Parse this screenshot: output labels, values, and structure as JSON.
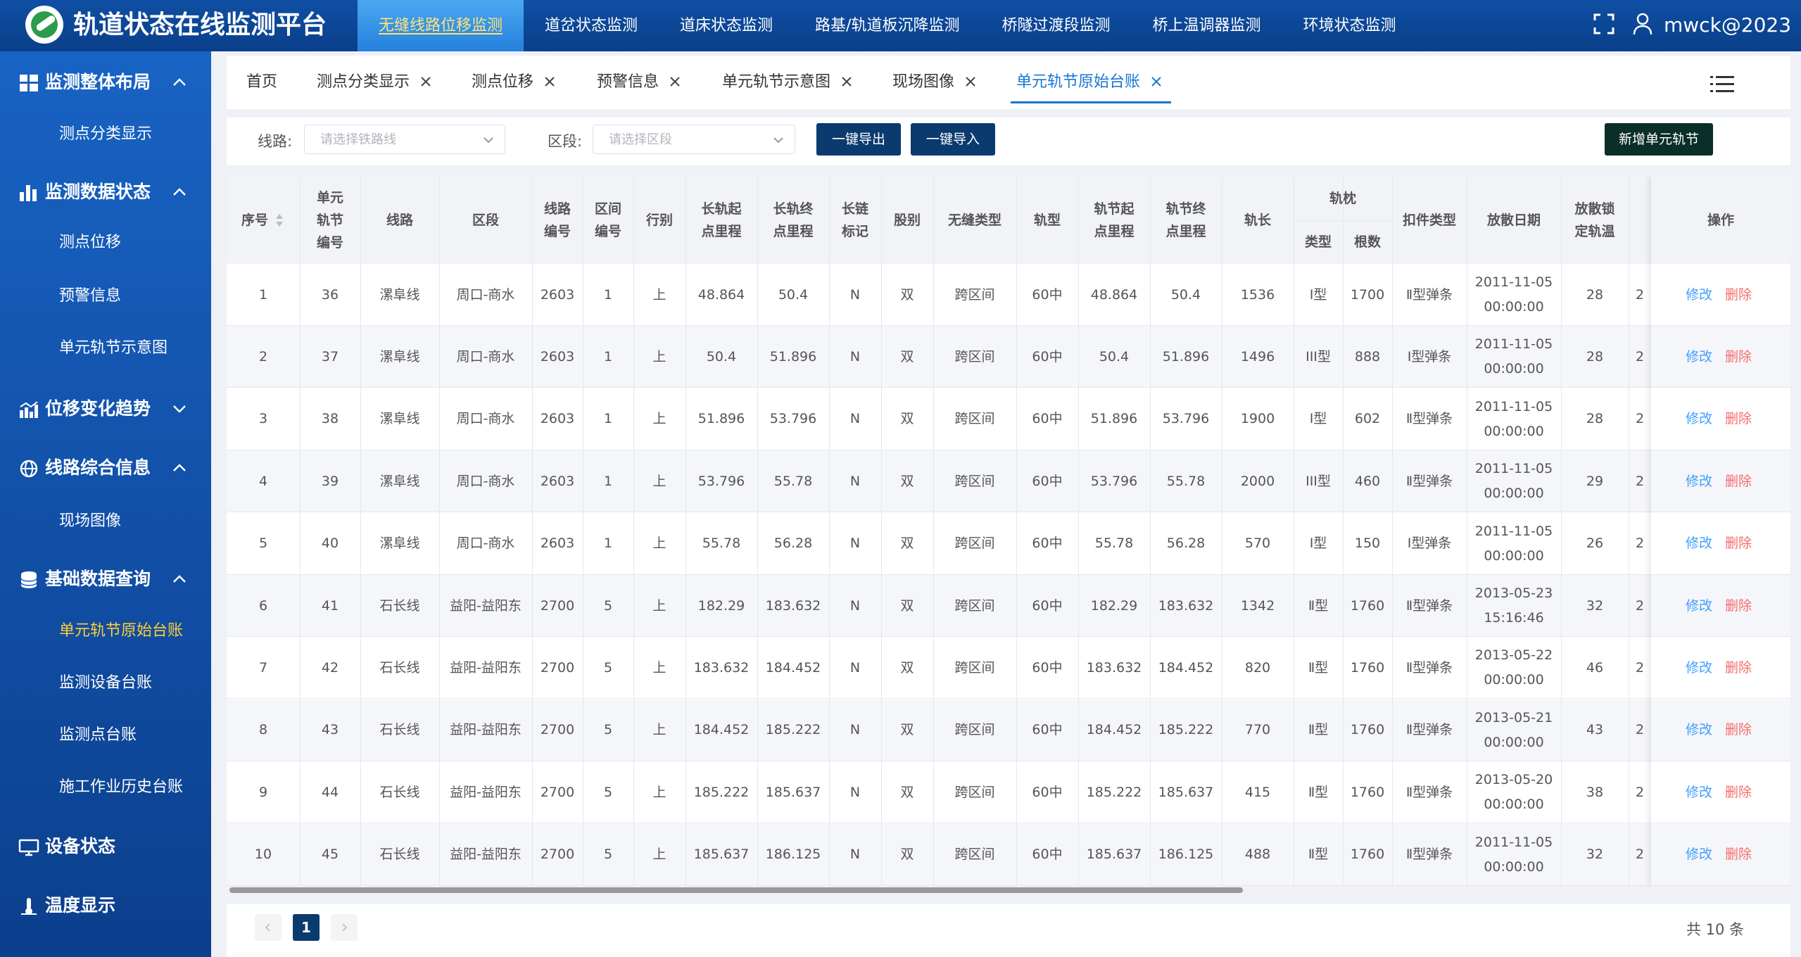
{
  "app": {
    "title": "轨道状态在线监测平台",
    "username": "mwck@2023"
  },
  "topnav": [
    "无缝线路位移监测",
    "道岔状态监测",
    "道床状态监测",
    "路基/轨道板沉降监测",
    "桥隧过渡段监测",
    "桥上温调器监测",
    "环境状态监测"
  ],
  "sidebar": {
    "groups": [
      "监测整体布局",
      "监测数据状态",
      "位移变化趋势",
      "线路综合信息",
      "基础数据查询",
      "设备状态",
      "温度显示"
    ],
    "subs": [
      "测点分类显示",
      "测点位移",
      "预警信息",
      "单元轨节示意图",
      "现场图像",
      "单元轨节原始台账",
      "监测设备台账",
      "监测点台账",
      "施工作业历史台账"
    ]
  },
  "tabs": [
    "首页",
    "测点分类显示",
    "测点位移",
    "预警信息",
    "单元轨节示意图",
    "现场图像",
    "单元轨节原始台账"
  ],
  "filters": {
    "line_label": "线路:",
    "line_placeholder": "请选择铁路线",
    "section_label": "区段:",
    "section_placeholder": "请选择区段",
    "export_btn": "一键导出",
    "import_btn": "一键导入",
    "add_btn": "新增单元轨节"
  },
  "table": {
    "headers": {
      "seq": "序号",
      "unit_a": "单元",
      "unit_b": "轨节",
      "unit_c": "编号",
      "line": "线路",
      "section": "区段",
      "lineno_a": "线路",
      "lineno_b": "编号",
      "secno_a": "区间",
      "secno_b": "编号",
      "dir": "行别",
      "ls_a": "长轨起",
      "ls_b": "点里程",
      "le_a": "长轨终",
      "le_b": "点里程",
      "chain_a": "长链",
      "chain_b": "标记",
      "strand": "股别",
      "seamless": "无缝类型",
      "rail": "轨型",
      "js_a": "轨节起",
      "js_b": "点里程",
      "je_a": "轨节终",
      "je_b": "点里程",
      "length": "轨长",
      "sleeper": "轨枕",
      "sl_type": "类型",
      "sl_count": "根数",
      "fastener": "扣件类型",
      "date": "放散日期",
      "lock_a": "放散锁",
      "lock_b": "定轨温",
      "op": "操作"
    },
    "rows": [
      {
        "seq": "1",
        "unit": "36",
        "line": "漯阜线",
        "section": "周口-商水",
        "lineno": "2603",
        "secno": "1",
        "dir": "上",
        "ls": "48.864",
        "le": "50.4",
        "chain": "N",
        "strand": "双",
        "seamless": "跨区间",
        "rail": "60中",
        "js": "48.864",
        "je": "50.4",
        "length": "1536",
        "sl_type": "Ⅰ型",
        "sl_count": "1700",
        "fastener": "Ⅱ型弹条",
        "date1": "2011-11-05",
        "date2": "00:00:00",
        "lock": "28",
        "extra": "2",
        "edit": "修改",
        "del": "删除"
      },
      {
        "seq": "2",
        "unit": "37",
        "line": "漯阜线",
        "section": "周口-商水",
        "lineno": "2603",
        "secno": "1",
        "dir": "上",
        "ls": "50.4",
        "le": "51.896",
        "chain": "N",
        "strand": "双",
        "seamless": "跨区间",
        "rail": "60中",
        "js": "50.4",
        "je": "51.896",
        "length": "1496",
        "sl_type": "III型",
        "sl_count": "888",
        "fastener": "I型弹条",
        "date1": "2011-11-05",
        "date2": "00:00:00",
        "lock": "28",
        "extra": "2",
        "edit": "修改",
        "del": "删除"
      },
      {
        "seq": "3",
        "unit": "38",
        "line": "漯阜线",
        "section": "周口-商水",
        "lineno": "2603",
        "secno": "1",
        "dir": "上",
        "ls": "51.896",
        "le": "53.796",
        "chain": "N",
        "strand": "双",
        "seamless": "跨区间",
        "rail": "60中",
        "js": "51.896",
        "je": "53.796",
        "length": "1900",
        "sl_type": "Ⅰ型",
        "sl_count": "602",
        "fastener": "Ⅱ型弹条",
        "date1": "2011-11-05",
        "date2": "00:00:00",
        "lock": "28",
        "extra": "2",
        "edit": "修改",
        "del": "删除"
      },
      {
        "seq": "4",
        "unit": "39",
        "line": "漯阜线",
        "section": "周口-商水",
        "lineno": "2603",
        "secno": "1",
        "dir": "上",
        "ls": "53.796",
        "le": "55.78",
        "chain": "N",
        "strand": "双",
        "seamless": "跨区间",
        "rail": "60中",
        "js": "53.796",
        "je": "55.78",
        "length": "2000",
        "sl_type": "III型",
        "sl_count": "460",
        "fastener": "Ⅱ型弹条",
        "date1": "2011-11-05",
        "date2": "00:00:00",
        "lock": "29",
        "extra": "2",
        "edit": "修改",
        "del": "删除"
      },
      {
        "seq": "5",
        "unit": "40",
        "line": "漯阜线",
        "section": "周口-商水",
        "lineno": "2603",
        "secno": "1",
        "dir": "上",
        "ls": "55.78",
        "le": "56.28",
        "chain": "N",
        "strand": "双",
        "seamless": "跨区间",
        "rail": "60中",
        "js": "55.78",
        "je": "56.28",
        "length": "570",
        "sl_type": "Ⅰ型",
        "sl_count": "150",
        "fastener": "I型弹条",
        "date1": "2011-11-05",
        "date2": "00:00:00",
        "lock": "26",
        "extra": "2",
        "edit": "修改",
        "del": "删除"
      },
      {
        "seq": "6",
        "unit": "41",
        "line": "石长线",
        "section": "益阳-益阳东",
        "lineno": "2700",
        "secno": "5",
        "dir": "上",
        "ls": "182.29",
        "le": "183.632",
        "chain": "N",
        "strand": "双",
        "seamless": "跨区间",
        "rail": "60中",
        "js": "182.29",
        "je": "183.632",
        "length": "1342",
        "sl_type": "Ⅱ型",
        "sl_count": "1760",
        "fastener": "Ⅱ型弹条",
        "date1": "2013-05-23",
        "date2": "15:16:46",
        "lock": "32",
        "extra": "2",
        "edit": "修改",
        "del": "删除"
      },
      {
        "seq": "7",
        "unit": "42",
        "line": "石长线",
        "section": "益阳-益阳东",
        "lineno": "2700",
        "secno": "5",
        "dir": "上",
        "ls": "183.632",
        "le": "184.452",
        "chain": "N",
        "strand": "双",
        "seamless": "跨区间",
        "rail": "60中",
        "js": "183.632",
        "je": "184.452",
        "length": "820",
        "sl_type": "Ⅱ型",
        "sl_count": "1760",
        "fastener": "Ⅱ型弹条",
        "date1": "2013-05-22",
        "date2": "00:00:00",
        "lock": "46",
        "extra": "2",
        "edit": "修改",
        "del": "删除"
      },
      {
        "seq": "8",
        "unit": "43",
        "line": "石长线",
        "section": "益阳-益阳东",
        "lineno": "2700",
        "secno": "5",
        "dir": "上",
        "ls": "184.452",
        "le": "185.222",
        "chain": "N",
        "strand": "双",
        "seamless": "跨区间",
        "rail": "60中",
        "js": "184.452",
        "je": "185.222",
        "length": "770",
        "sl_type": "Ⅱ型",
        "sl_count": "1760",
        "fastener": "Ⅱ型弹条",
        "date1": "2013-05-21",
        "date2": "00:00:00",
        "lock": "43",
        "extra": "2",
        "edit": "修改",
        "del": "删除"
      },
      {
        "seq": "9",
        "unit": "44",
        "line": "石长线",
        "section": "益阳-益阳东",
        "lineno": "2700",
        "secno": "5",
        "dir": "上",
        "ls": "185.222",
        "le": "185.637",
        "chain": "N",
        "strand": "双",
        "seamless": "跨区间",
        "rail": "60中",
        "js": "185.222",
        "je": "185.637",
        "length": "415",
        "sl_type": "Ⅱ型",
        "sl_count": "1760",
        "fastener": "Ⅱ型弹条",
        "date1": "2013-05-20",
        "date2": "00:00:00",
        "lock": "38",
        "extra": "2",
        "edit": "修改",
        "del": "删除"
      },
      {
        "seq": "10",
        "unit": "45",
        "line": "石长线",
        "section": "益阳-益阳东",
        "lineno": "2700",
        "secno": "5",
        "dir": "上",
        "ls": "185.637",
        "le": "186.125",
        "chain": "N",
        "strand": "双",
        "seamless": "跨区间",
        "rail": "60中",
        "js": "185.637",
        "je": "186.125",
        "length": "488",
        "sl_type": "Ⅱ型",
        "sl_count": "1760",
        "fastener": "Ⅱ型弹条",
        "date1": "2011-11-05",
        "date2": "00:00:00",
        "lock": "32",
        "extra": "2",
        "edit": "修改",
        "del": "删除"
      }
    ]
  },
  "pagination": {
    "current": "1",
    "total": "共 10 条"
  },
  "colors": {
    "topbar": "#0f4fa3",
    "sidebar": "#1863c4",
    "active_nav_text": "#ffe27a",
    "active_sub": "#ffcf35",
    "primary": "#1976d2",
    "dark_button": "#0b3a6e",
    "edit_link": "#409eff",
    "delete_link": "#f56c6c"
  }
}
